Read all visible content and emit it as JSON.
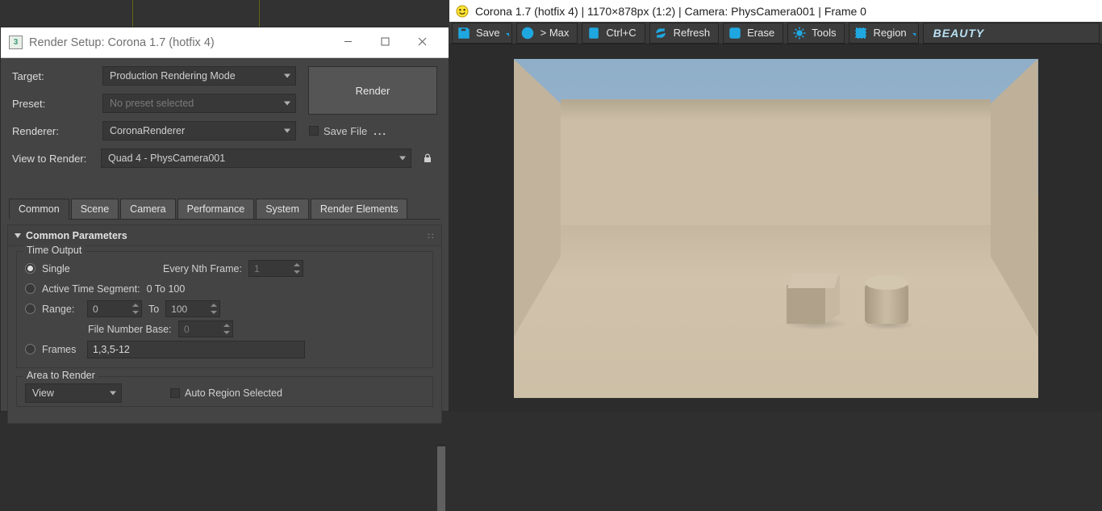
{
  "window": {
    "title": "Render Setup: Corona 1.7 (hotfix 4)",
    "render_button": "Render",
    "target_label": "Target:",
    "target_value": "Production Rendering Mode",
    "preset_label": "Preset:",
    "preset_value": "No preset selected",
    "renderer_label": "Renderer:",
    "renderer_value": "CoronaRenderer",
    "save_file_label": "Save File",
    "view_label": "View to Render:",
    "view_value": "Quad 4 - PhysCamera001",
    "tabs": [
      "Common",
      "Scene",
      "Camera",
      "Performance",
      "System",
      "Render Elements"
    ],
    "active_tab": 0,
    "rollout_title": "Common Parameters",
    "time_output": {
      "legend": "Time Output",
      "single": "Single",
      "every_nth": "Every Nth Frame:",
      "every_nth_val": "1",
      "active_segment": "Active Time Segment:",
      "active_range": "0 To 100",
      "range": "Range:",
      "range_from": "0",
      "range_to_lbl": "To",
      "range_to": "100",
      "file_base": "File Number Base:",
      "file_base_val": "0",
      "frames": "Frames",
      "frames_val": "1,3,5-12"
    },
    "area_to_render": {
      "legend": "Area to Render",
      "mode": "View",
      "auto_region": "Auto Region Selected"
    }
  },
  "renderview": {
    "title": "Corona 1.7 (hotfix 4) | 1170×878px (1:2) | Camera: PhysCamera001 | Frame 0",
    "toolbar": {
      "save": "Save",
      "max": "> Max",
      "ctrlc": "Ctrl+C",
      "refresh": "Refresh",
      "erase": "Erase",
      "tools": "Tools",
      "region": "Region",
      "channel": "BEAUTY"
    }
  }
}
